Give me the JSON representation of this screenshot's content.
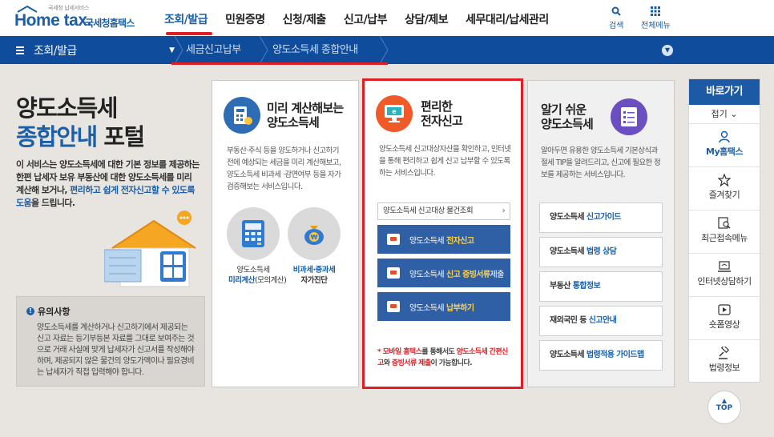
{
  "header": {
    "logo_small": "국세청 납세서비스",
    "logo_main": "Home tax.",
    "logo_kr": "국세청홈택스",
    "nav": [
      "조회/발급",
      "민원증명",
      "신청/제출",
      "신고/납부",
      "상담/제보",
      "세무대리/납세관리"
    ],
    "search_label": "검색",
    "allmenu_label": "전체메뉴"
  },
  "breadcrumb": {
    "home_label": "조회/발급",
    "items": [
      "세금신고납부",
      "양도소득세 종합안내"
    ]
  },
  "intro": {
    "title_line1": "양도소득세",
    "title_line2_highlight": "종합안내",
    "title_line2_rest": " 포털",
    "desc_part1": "이 서비스는 양도소득세에 대한 기본 정보를 제공하는 한편 납세자 보유 부동산에 대한 양도소득세를 미리 계산해 보거나, ",
    "desc_highlight": "편리하고 쉽게 전자신고할 수 있도록 도움",
    "desc_part2": "을 드립니다.",
    "notice_title": "유의사항",
    "notice_body": "양도소득세를 계산하거나 신고하기에서 제공되는 신고 자료는 등기부등본 자료를 그대로 보여주는 것으로 거래 사실에 맞게 납세자가 신고서를 작성해야 하며, 제공되지 않은 물건의 양도가액이나 필요경비는 납세자가 직접 입력해야 합니다."
  },
  "card1": {
    "title_line1": "미리 계산해보는",
    "title_line2": "양도소득세",
    "desc": "부동산·주식 등을 양도하거나 신고하기 전에 예상되는 세금을 미리 계산해보고, 양도소득세 비과세 ·감면여부 등을 자가검증해보는 서비스입니다.",
    "item1_line1": "양도소득세",
    "item1_line2": "미리계산",
    "item1_line2_rest": "(모의계산)",
    "item2_line1_blue": "비과세·중과세",
    "item2_line2": "자가진단"
  },
  "card2": {
    "title_line1": "편리한",
    "title_line2": "전자신고",
    "desc": "양도소득세 신고대상자산을 확인하고, 인터넷을 통해 편리하고 쉽게 신고 납부할 수 있도록 하는 서비스입니다.",
    "select_label": "양도소득세 신고대상 물건조회",
    "buttons": [
      {
        "prefix": "양도소득세",
        "highlight": "전자신고",
        "suffix": ""
      },
      {
        "prefix": "양도소득세",
        "highlight": "신고 증빙서류",
        "suffix": " 제출"
      },
      {
        "prefix": "양도소득세",
        "highlight": "납부하기",
        "suffix": ""
      }
    ],
    "note_part1": "* 모바일 홈택스",
    "note_part2": "를 통해서도 ",
    "note_part3": "양도소득세 간편신고",
    "note_part4": "와 ",
    "note_part5": "증빙서류 제출",
    "note_part6": "이 가능합니다."
  },
  "card3": {
    "title_line1": "알기 쉬운",
    "title_line2": "양도소득세",
    "desc": "알아두면 유용한 양도소득세 기본상식과 절세 TIP을 알려드리고, 신고에 필요한 정보를 제공하는 서비스입니다.",
    "links": [
      {
        "prefix": "양도소득세 ",
        "highlight": "신고가이드"
      },
      {
        "prefix": "양도소득세 ",
        "highlight": "법령 상담"
      },
      {
        "prefix": "부동산 ",
        "highlight": "통합정보"
      },
      {
        "prefix": "재외국민 등 ",
        "highlight": "신고안내"
      },
      {
        "prefix": "양도소득세 ",
        "highlight": "법령적용 가이드맵"
      }
    ]
  },
  "quick": {
    "title": "바로가기",
    "fold": "접기",
    "items": [
      "My홈택스",
      "즐겨찾기",
      "최근접속메뉴",
      "인터넷상담하기",
      "숏폼영상",
      "법령정보"
    ],
    "top_label": "TOP"
  },
  "colors": {
    "brand_blue": "#1a5fa8",
    "nav_bar": "#0f4c9c",
    "red_highlight": "#e01e26",
    "button_blue": "#2f5fa5",
    "accent_yellow": "#ffd44a"
  }
}
